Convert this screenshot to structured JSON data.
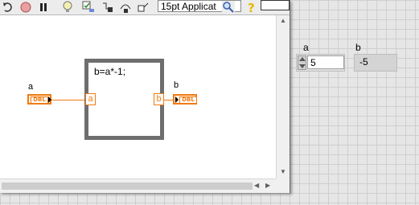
{
  "toolbar": {
    "font_select_value": "15pt Applicat",
    "icons": [
      "run-continuously-icon",
      "abort-icon",
      "pause-icon",
      "highlight-execution-icon",
      "retain-wire-values-icon",
      "step-into-icon",
      "step-over-icon",
      "step-out-icon",
      "font-icon",
      "search-icon",
      "help-icon"
    ]
  },
  "block_diagram": {
    "control_terminal": {
      "label": "a",
      "type": "DBL"
    },
    "indicator_terminal": {
      "label": "b",
      "type": "DBL"
    },
    "formula_node": {
      "expression": "b=a*-1;",
      "input_tunnel": "a",
      "output_tunnel": "b"
    }
  },
  "front_panel": {
    "control_a": {
      "label": "a",
      "value": "5"
    },
    "indicator_b": {
      "label": "b",
      "value": "-5"
    }
  },
  "colors": {
    "wire_orange": "#f07b14",
    "node_border": "#6e6e6e",
    "grid": "#cfcfcf"
  }
}
